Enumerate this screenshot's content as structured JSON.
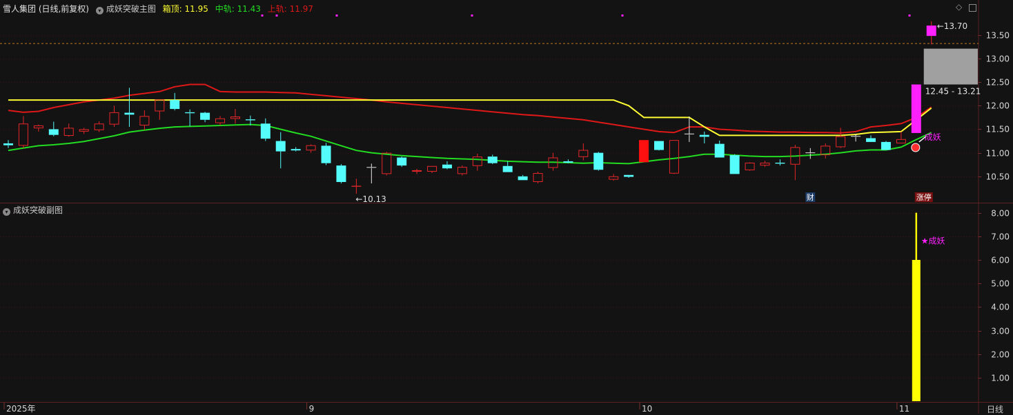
{
  "header": {
    "stock_title": "雪人集团 (日线,前复权)",
    "main_indicator": "成妖突破主图",
    "box_top_label": "箱顶: 11.95",
    "mid_label": "中轨: 11.43",
    "upper_label": "上轨: 11.97",
    "sub_indicator": "成妖突破副图",
    "period": "日线"
  },
  "colors": {
    "up": "#e8262a",
    "down": "#54fcfc",
    "upper": "#e01818",
    "mid": "#22dd22",
    "box": "#ffff33",
    "magenta": "#ff20ff",
    "grid": "#3c1414",
    "sub_bar": "#ffff00"
  },
  "chart_data": [
    {
      "type": "candlestick",
      "title": "成妖突破主图",
      "y_ticks": [
        "10.50",
        "11.00",
        "11.50",
        "12.00",
        "12.50",
        "13.00",
        "13.50"
      ],
      "ylim": [
        10.0,
        13.95
      ],
      "x_ticks": [
        "2025年",
        "9",
        "10",
        "11"
      ],
      "x_tick_index": [
        0,
        20,
        42,
        59
      ],
      "candles": [
        [
          11.2,
          11.27,
          11.1,
          11.16
        ],
        [
          11.15,
          11.78,
          11.1,
          11.62
        ],
        [
          11.52,
          11.6,
          11.45,
          11.58
        ],
        [
          11.5,
          11.66,
          11.35,
          11.38
        ],
        [
          11.36,
          11.62,
          11.34,
          11.53
        ],
        [
          11.45,
          11.53,
          11.4,
          11.5
        ],
        [
          11.48,
          11.67,
          11.44,
          11.62
        ],
        [
          11.6,
          12.0,
          11.55,
          11.86
        ],
        [
          11.85,
          12.38,
          11.55,
          11.81
        ],
        [
          11.58,
          11.9,
          11.48,
          11.78
        ],
        [
          11.88,
          12.12,
          11.7,
          12.13
        ],
        [
          12.12,
          12.27,
          11.9,
          11.93
        ],
        [
          11.86,
          11.92,
          11.56,
          11.84
        ],
        [
          11.85,
          11.87,
          11.65,
          11.7
        ],
        [
          11.63,
          11.78,
          11.58,
          11.73
        ],
        [
          11.72,
          11.93,
          11.62,
          11.77
        ],
        [
          11.71,
          11.79,
          11.58,
          11.69
        ],
        [
          11.62,
          11.73,
          11.25,
          11.3
        ],
        [
          11.25,
          11.44,
          10.67,
          11.03
        ],
        [
          11.08,
          11.12,
          11.03,
          11.05
        ],
        [
          11.05,
          11.18,
          11.0,
          11.16
        ],
        [
          11.15,
          11.21,
          10.74,
          10.78
        ],
        [
          10.73,
          10.76,
          10.35,
          10.38
        ],
        [
          10.28,
          10.45,
          10.13,
          10.3
        ],
        [
          10.69,
          10.77,
          10.35,
          10.68
        ],
        [
          10.55,
          11.02,
          10.52,
          11.0
        ],
        [
          10.9,
          10.92,
          10.7,
          10.73
        ],
        [
          10.6,
          10.66,
          10.55,
          10.63
        ],
        [
          10.6,
          10.72,
          10.57,
          10.72
        ],
        [
          10.75,
          10.82,
          10.65,
          10.67
        ],
        [
          10.55,
          10.73,
          10.52,
          10.7
        ],
        [
          10.72,
          10.98,
          10.62,
          10.92
        ],
        [
          10.92,
          10.96,
          10.76,
          10.78
        ],
        [
          10.72,
          10.82,
          10.59,
          10.59
        ],
        [
          10.5,
          10.53,
          10.42,
          10.42
        ],
        [
          10.38,
          10.6,
          10.35,
          10.57
        ],
        [
          10.68,
          11.0,
          10.62,
          10.9
        ],
        [
          10.82,
          10.86,
          10.78,
          10.79
        ],
        [
          10.91,
          11.2,
          10.84,
          11.06
        ],
        [
          11.0,
          11.02,
          10.62,
          10.64
        ],
        [
          10.43,
          10.55,
          10.41,
          10.5
        ],
        [
          10.53,
          10.53,
          10.47,
          10.49
        ],
        [
          10.8,
          11.27,
          10.8,
          11.27
        ],
        [
          11.25,
          11.25,
          11.05,
          11.06
        ],
        [
          10.56,
          11.27,
          10.55,
          11.27
        ],
        [
          11.4,
          11.77,
          11.23,
          11.4
        ],
        [
          11.38,
          11.45,
          11.2,
          11.34
        ],
        [
          11.19,
          11.26,
          10.9,
          10.9
        ],
        [
          10.95,
          10.97,
          10.55,
          10.55
        ],
        [
          10.63,
          10.8,
          10.62,
          10.79
        ],
        [
          10.73,
          10.83,
          10.7,
          10.79
        ],
        [
          10.79,
          10.86,
          10.73,
          10.77
        ],
        [
          10.75,
          11.17,
          10.42,
          11.12
        ],
        [
          11.0,
          11.1,
          10.87,
          11.0
        ],
        [
          10.95,
          11.2,
          10.88,
          11.15
        ],
        [
          11.12,
          11.53,
          11.1,
          11.35
        ],
        [
          11.35,
          11.4,
          11.24,
          11.34
        ],
        [
          11.31,
          11.37,
          11.23,
          11.23
        ],
        [
          11.23,
          11.25,
          11.06,
          11.06
        ],
        [
          11.2,
          11.45,
          11.2,
          11.29
        ],
        [
          11.42,
          12.45,
          11.42,
          12.45
        ],
        [
          13.48,
          13.79,
          13.3,
          13.7
        ]
      ],
      "series": [
        {
          "name": "上轨",
          "values": [
            11.9,
            11.86,
            11.88,
            11.96,
            12.02,
            12.08,
            12.12,
            12.16,
            12.22,
            12.26,
            12.3,
            12.4,
            12.45,
            12.45,
            12.3,
            12.29,
            12.29,
            12.29,
            12.28,
            12.27,
            12.24,
            12.21,
            12.18,
            12.15,
            12.12,
            12.08,
            12.05,
            12.02,
            11.99,
            11.96,
            11.93,
            11.9,
            11.87,
            11.84,
            11.81,
            11.79,
            11.76,
            11.73,
            11.7,
            11.65,
            11.6,
            11.55,
            11.5,
            11.45,
            11.43,
            11.55,
            11.55,
            11.5,
            11.48,
            11.46,
            11.45,
            11.44,
            11.44,
            11.43,
            11.43,
            11.42,
            11.45,
            11.55,
            11.58,
            11.62,
            11.75,
            11.97
          ]
        },
        {
          "name": "中轨",
          "values": [
            11.05,
            11.1,
            11.15,
            11.17,
            11.2,
            11.24,
            11.3,
            11.36,
            11.44,
            11.48,
            11.52,
            11.55,
            11.56,
            11.57,
            11.58,
            11.59,
            11.6,
            11.58,
            11.5,
            11.42,
            11.35,
            11.25,
            11.15,
            11.05,
            11.0,
            10.97,
            10.94,
            10.92,
            10.9,
            10.88,
            10.87,
            10.86,
            10.84,
            10.82,
            10.81,
            10.8,
            10.8,
            10.79,
            10.78,
            10.79,
            10.78,
            10.77,
            10.81,
            10.85,
            10.88,
            10.92,
            10.97,
            10.97,
            10.95,
            10.93,
            10.92,
            10.92,
            10.93,
            10.95,
            10.97,
            11.0,
            11.04,
            11.06,
            11.06,
            11.12,
            11.28,
            11.43
          ]
        },
        {
          "name": "箱顶",
          "values": [
            12.12,
            12.12,
            12.12,
            12.12,
            12.12,
            12.12,
            12.12,
            12.12,
            12.12,
            12.12,
            12.12,
            12.12,
            12.12,
            12.12,
            12.12,
            12.12,
            12.12,
            12.12,
            12.12,
            12.12,
            12.12,
            12.12,
            12.12,
            12.12,
            12.12,
            12.12,
            12.12,
            12.12,
            12.12,
            12.12,
            12.12,
            12.12,
            12.12,
            12.12,
            12.12,
            12.12,
            12.12,
            12.12,
            12.12,
            12.12,
            12.12,
            12.0,
            11.75,
            11.75,
            11.75,
            11.75,
            11.55,
            11.37,
            11.37,
            11.37,
            11.37,
            11.37,
            11.37,
            11.37,
            11.37,
            11.37,
            11.39,
            11.43,
            11.44,
            11.45,
            11.7,
            11.95
          ]
        }
      ],
      "annotations": [
        {
          "text": "←10.13",
          "index": 23,
          "value": 10.13
        },
        {
          "text": "←13.70",
          "index": 61,
          "value": 13.7
        },
        {
          "text": "12.45 - 13.21",
          "index": 61,
          "range": [
            12.45,
            13.21
          ]
        },
        {
          "text": "成妖",
          "index": 60,
          "value": 11.2
        },
        {
          "text": "财",
          "index": 53
        },
        {
          "text": "涨停",
          "index": 60
        }
      ]
    },
    {
      "type": "bar",
      "title": "成妖突破副图",
      "y_ticks": [
        "1.00",
        "2.00",
        "3.00",
        "4.00",
        "5.00",
        "6.00",
        "7.00",
        "8.00"
      ],
      "ylim": [
        0,
        8.4
      ],
      "index": 60,
      "value": 6.0,
      "high": 8.0,
      "annotation": "★成妖"
    }
  ]
}
